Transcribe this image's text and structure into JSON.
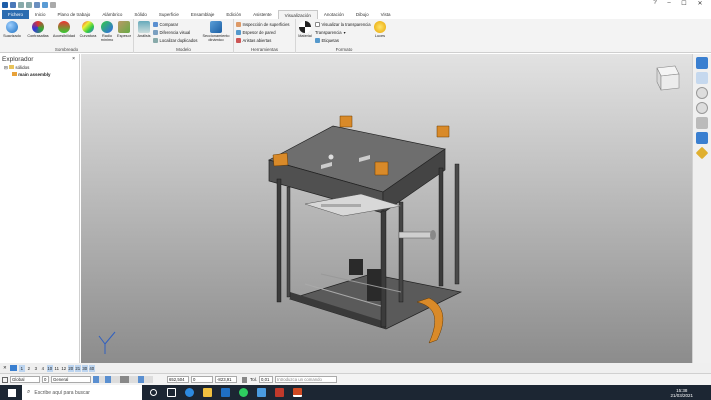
{
  "titlebar": {
    "help": "?",
    "minimize": "–",
    "maximize": "☐",
    "close": "✕"
  },
  "ribbon_tabs": [
    "Fichero",
    "Inicio",
    "Plano de trabajo",
    "Alámbrico",
    "Sólido",
    "Superficie",
    "Ensamblaje",
    "Edición",
    "Asistente",
    "Visualización",
    "Anotación",
    "Dibujo",
    "Vista"
  ],
  "active_tab": "Visualización",
  "ribbon": {
    "groups": {
      "sombreado": "Sombreado",
      "modelo": "Modelo",
      "herramientas": "Herramientas",
      "formato": "Formato"
    },
    "sombreado": [
      "Suavizado",
      "Contrasaltas",
      "Accesibilidad",
      "Curvatura",
      "Radio mínimo",
      "Espesor"
    ],
    "modelo_big": "Análisis",
    "modelo_small": [
      "Comparar",
      "Diferencia visual",
      "Localizar duplicados"
    ],
    "seccionamiento": "Seccionamiento dinámico",
    "herramientas": [
      "Inspección de superficies",
      "Espesor de pared",
      "Aristas abiertas"
    ],
    "material": "Material",
    "formato": [
      "Visualizar la transparencia",
      "Transparencia",
      "Etiquetas"
    ],
    "luces": "Luces"
  },
  "explorer": {
    "title": "Explorador",
    "close": "×",
    "items": [
      "sólidos",
      "main assembly"
    ]
  },
  "pages": [
    "1",
    "2",
    "3",
    "4",
    "10",
    "11",
    "12",
    "20",
    "21",
    "30",
    "40"
  ],
  "cmdbar": {
    "plane": "Global",
    "layer_num": "0",
    "layer": "General",
    "x": "652,504",
    "y": "0",
    "z": "-823,91",
    "tol_label": "Tol.",
    "tol": "0,01",
    "command_placeholder": "Introduzca un comando"
  },
  "taskbar": {
    "search": "Escribe aquí para buscar",
    "time": "15:38",
    "date": "21/03/2021"
  },
  "colors": {
    "file_tab": "#2b6cb0",
    "taskbar": "#1c2633",
    "viewport_top": "#e2e2e2",
    "viewport_bottom": "#8c8c8c"
  }
}
